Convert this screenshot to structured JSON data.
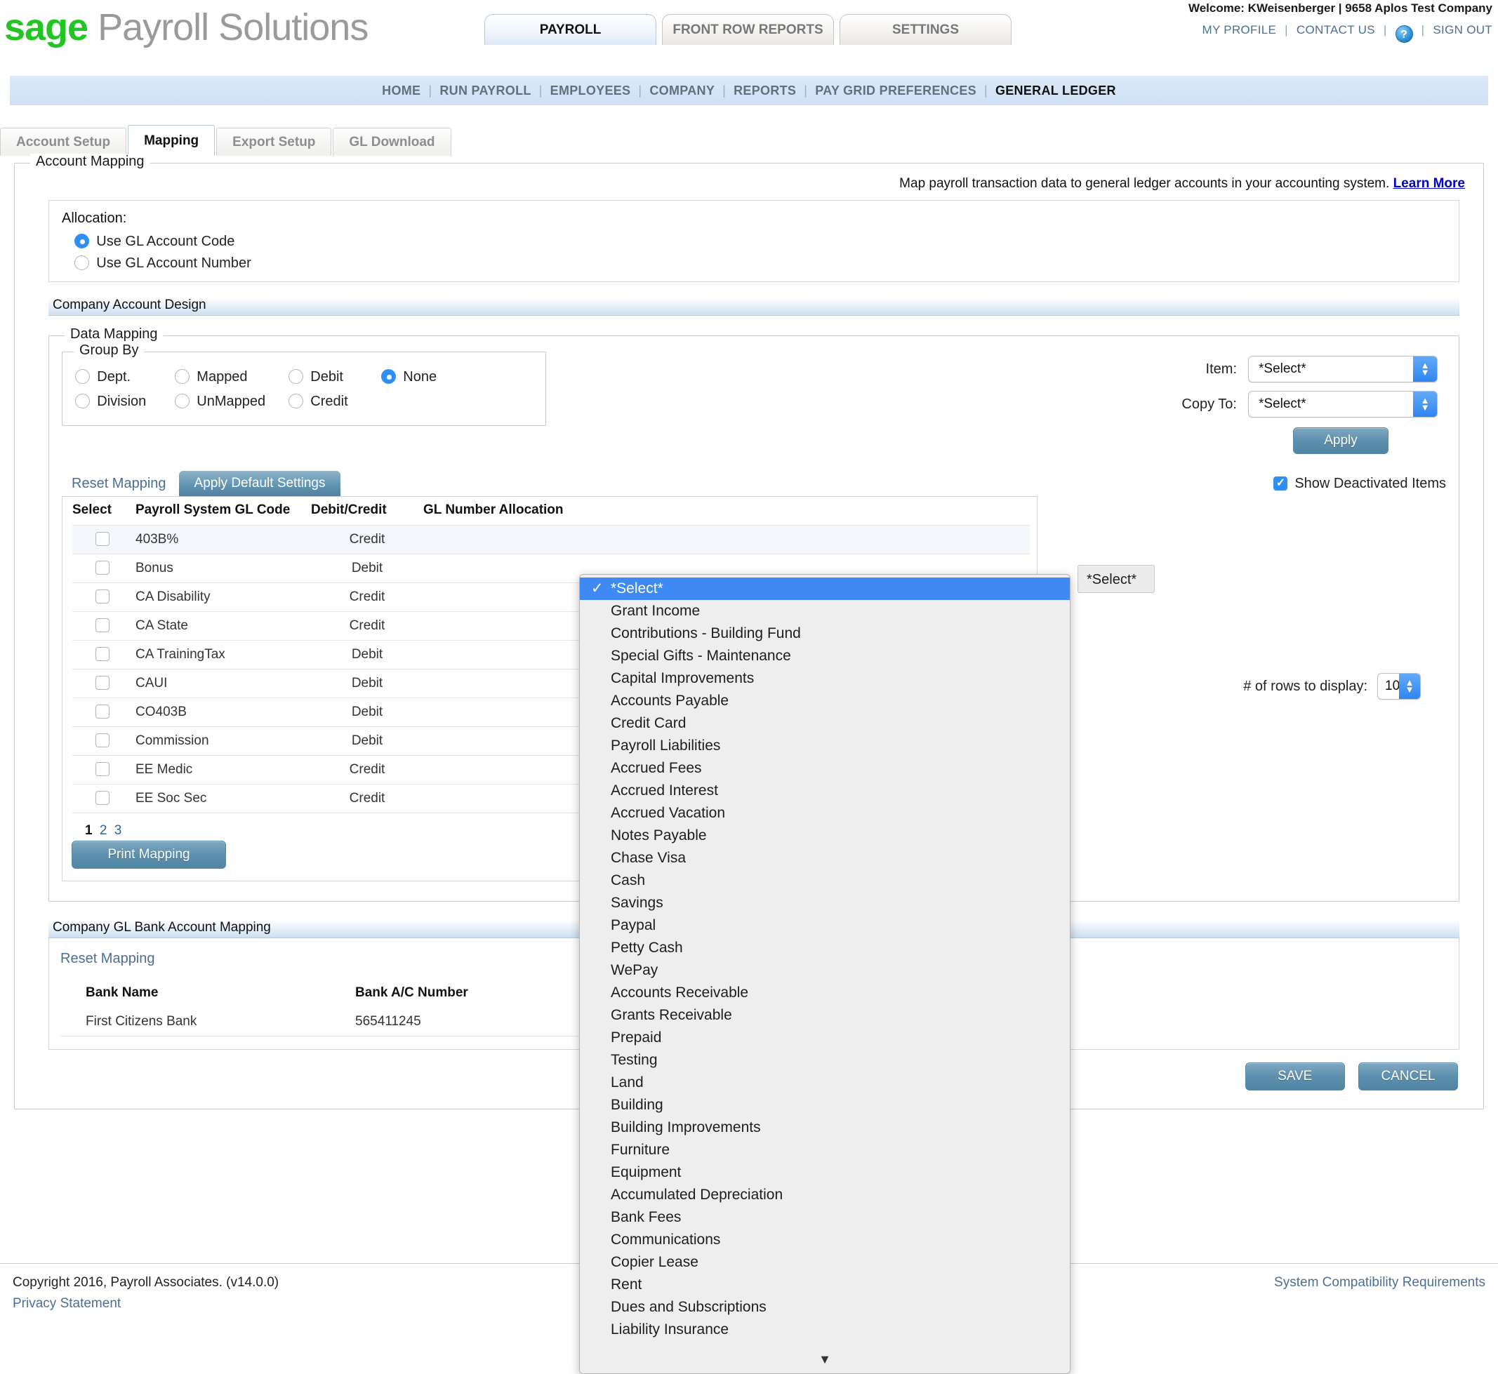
{
  "brand": {
    "name_bold": "sage",
    "name_light": "Payroll Solutions"
  },
  "header": {
    "welcome": "Welcome: KWeisenberger  |  9658 Aplos Test Company",
    "links": {
      "profile": "MY PROFILE",
      "contact": "CONTACT US",
      "help_icon": "?",
      "signout": "SIGN OUT"
    }
  },
  "main_tabs": [
    {
      "label": "PAYROLL",
      "active": true
    },
    {
      "label": "FRONT ROW REPORTS",
      "active": false
    },
    {
      "label": "SETTINGS",
      "active": false
    }
  ],
  "nav": [
    {
      "label": "HOME",
      "current": false
    },
    {
      "label": "RUN PAYROLL",
      "current": false
    },
    {
      "label": "EMPLOYEES",
      "current": false
    },
    {
      "label": "COMPANY",
      "current": false
    },
    {
      "label": "REPORTS",
      "current": false
    },
    {
      "label": "PAY GRID PREFERENCES",
      "current": false
    },
    {
      "label": "GENERAL LEDGER",
      "current": true
    }
  ],
  "sub_tabs": [
    {
      "label": "Account Setup",
      "active": false
    },
    {
      "label": "Mapping",
      "active": true
    },
    {
      "label": "Export Setup",
      "active": false
    },
    {
      "label": "GL Download",
      "active": false
    }
  ],
  "account_mapping": {
    "legend": "Account Mapping",
    "hint_text": "Map payroll transaction data to general ledger accounts in your accounting system.",
    "hint_link": "Learn More",
    "allocation": {
      "label": "Allocation:",
      "options": [
        {
          "label": "Use GL Account Code",
          "selected": true
        },
        {
          "label": "Use GL Account Number",
          "selected": false
        }
      ]
    },
    "company_account_design": "Company Account Design"
  },
  "data_mapping": {
    "legend": "Data Mapping",
    "group_by": {
      "legend": "Group By",
      "row1": [
        {
          "label": "Dept.",
          "selected": false
        },
        {
          "label": "Mapped",
          "selected": false
        },
        {
          "label": "Debit",
          "selected": false
        },
        {
          "label": "None",
          "selected": true
        }
      ],
      "row2": [
        {
          "label": "Division",
          "selected": false
        },
        {
          "label": "UnMapped",
          "selected": false
        },
        {
          "label": "Credit",
          "selected": false
        }
      ]
    },
    "item_label": "Item:",
    "item_value": "*Select*",
    "copy_to_label": "Copy To:",
    "copy_to_value": "*Select*",
    "apply_button": "Apply",
    "reset_mapping": "Reset Mapping",
    "apply_default_settings": "Apply Default Settings",
    "show_deactivated_label": "Show Deactivated Items",
    "show_deactivated_checked": true,
    "rows_label": "# of rows to display:",
    "rows_value": "10",
    "print_mapping": "Print Mapping",
    "columns": [
      "Select",
      "Payroll System GL Code",
      "Debit/Credit",
      "GL Number Allocation"
    ],
    "rows": [
      {
        "code": "403B%",
        "dc": "Credit",
        "checked": false
      },
      {
        "code": "Bonus",
        "dc": "Debit",
        "checked": false
      },
      {
        "code": "CA Disability",
        "dc": "Credit",
        "checked": false
      },
      {
        "code": "CA State",
        "dc": "Credit",
        "checked": false
      },
      {
        "code": "CA TrainingTax",
        "dc": "Debit",
        "checked": false
      },
      {
        "code": "CAUI",
        "dc": "Debit",
        "checked": false
      },
      {
        "code": "CO403B",
        "dc": "Debit",
        "checked": false
      },
      {
        "code": "Commission",
        "dc": "Debit",
        "checked": false
      },
      {
        "code": "EE Medic",
        "dc": "Credit",
        "checked": false
      },
      {
        "code": "EE Soc Sec",
        "dc": "Credit",
        "checked": false
      }
    ],
    "pager": {
      "current": "1",
      "pages": [
        "2",
        "3"
      ]
    }
  },
  "gl_dropdown": {
    "closed_value": "*Select*",
    "scroll_indicator": "▼",
    "options": [
      {
        "label": "*Select*",
        "selected": true
      },
      {
        "label": "Grant Income",
        "selected": false
      },
      {
        "label": "Contributions - Building Fund",
        "selected": false
      },
      {
        "label": "Special Gifts - Maintenance",
        "selected": false
      },
      {
        "label": "Capital Improvements",
        "selected": false
      },
      {
        "label": "Accounts Payable",
        "selected": false
      },
      {
        "label": "Credit Card",
        "selected": false
      },
      {
        "label": "Payroll Liabilities",
        "selected": false
      },
      {
        "label": "Accrued Fees",
        "selected": false
      },
      {
        "label": "Accrued Interest",
        "selected": false
      },
      {
        "label": "Accrued Vacation",
        "selected": false
      },
      {
        "label": "Notes Payable",
        "selected": false
      },
      {
        "label": "Chase Visa",
        "selected": false
      },
      {
        "label": "Cash",
        "selected": false
      },
      {
        "label": "Savings",
        "selected": false
      },
      {
        "label": "Paypal",
        "selected": false
      },
      {
        "label": "Petty Cash",
        "selected": false
      },
      {
        "label": "WePay",
        "selected": false
      },
      {
        "label": "Accounts Receivable",
        "selected": false
      },
      {
        "label": "Grants Receivable",
        "selected": false
      },
      {
        "label": "Prepaid",
        "selected": false
      },
      {
        "label": "Testing",
        "selected": false
      },
      {
        "label": "Land",
        "selected": false
      },
      {
        "label": "Building",
        "selected": false
      },
      {
        "label": "Building Improvements",
        "selected": false
      },
      {
        "label": "Furniture",
        "selected": false
      },
      {
        "label": "Equipment",
        "selected": false
      },
      {
        "label": "Accumulated Depreciation",
        "selected": false
      },
      {
        "label": "Bank Fees",
        "selected": false
      },
      {
        "label": "Communications",
        "selected": false
      },
      {
        "label": "Copier Lease",
        "selected": false
      },
      {
        "label": "Rent",
        "selected": false
      },
      {
        "label": "Dues and Subscriptions",
        "selected": false
      },
      {
        "label": "Liability Insurance",
        "selected": false
      }
    ]
  },
  "bank_mapping": {
    "section_title": "Company GL Bank Account Mapping",
    "reset_mapping": "Reset Mapping",
    "columns": [
      "Bank Name",
      "Bank A/C Number"
    ],
    "rows": [
      {
        "bank_name": "First Citizens Bank",
        "account_number": "565411245"
      }
    ]
  },
  "actions": {
    "save": "SAVE",
    "cancel": "CANCEL"
  },
  "footer": {
    "copyright": "Copyright 2016, Payroll Associates. (v14.0.0)",
    "privacy": "Privacy Statement",
    "compat": "System Compatibility Requirements"
  }
}
